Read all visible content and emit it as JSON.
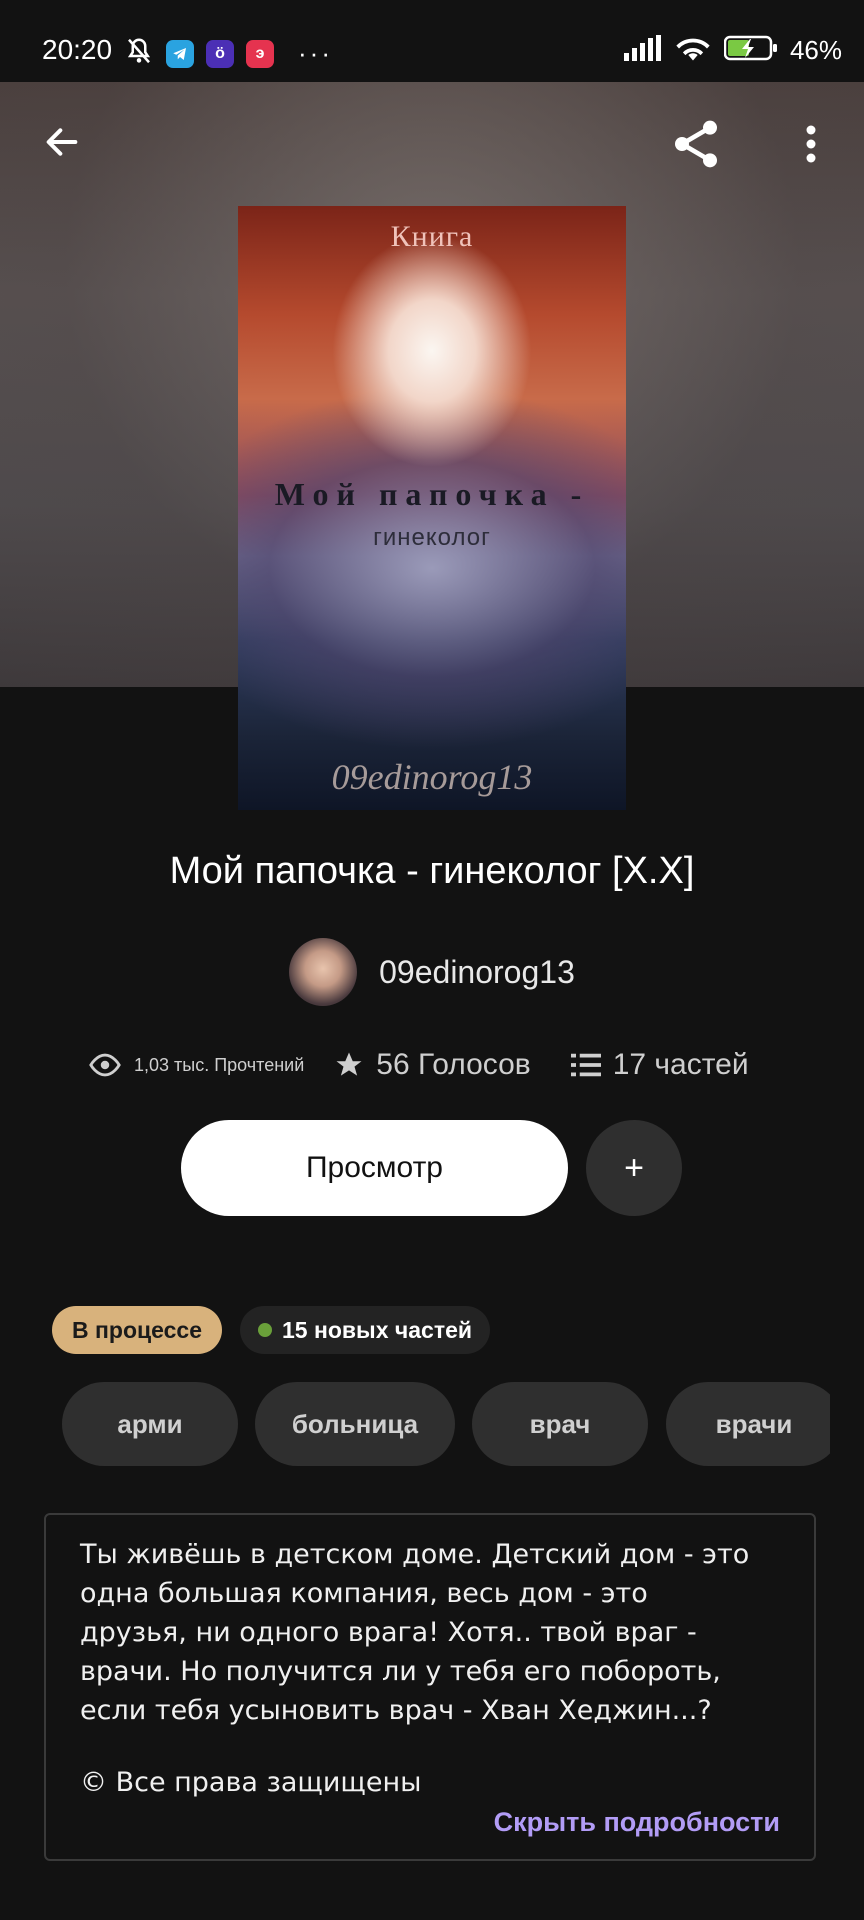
{
  "status_bar": {
    "time": "20:20",
    "battery": "46%",
    "icons": [
      "muted-bell-icon",
      "telegram-icon",
      "app-icon",
      "app-icon",
      "more-icon",
      "signal-icon",
      "wifi-icon",
      "battery-icon"
    ]
  },
  "header": {
    "back_icon": "back-arrow-icon",
    "share_icon": "share-icon",
    "menu_icon": "more-vertical-icon"
  },
  "cover": {
    "top_text": "Книга",
    "title_text": "Мой папочка -",
    "subtitle_text": "гинеколог",
    "author_text": "09edinorog13"
  },
  "book": {
    "title": "Мой папочка - гинеколог [X.X]",
    "author": "09edinorog13"
  },
  "stats": {
    "reads": "1,03 тыс. Прочтений",
    "votes": "56 Голосов",
    "parts": "17 частей"
  },
  "actions": {
    "view_label": "Просмотр",
    "add_label": "+"
  },
  "badges": {
    "status": "В процессе",
    "new_parts": "15 новых частей"
  },
  "tags": [
    "арми",
    "больница",
    "врач",
    "врачи"
  ],
  "description": {
    "text": "Ты живёшь в детском доме. Детский дом - это одна большая компания, весь дом - это друзья, ни одного врага! Хотя.. твой враг - врачи. Но получится ли у тебя его побороть, если тебя усыновить врач - Хван Хеджин...?",
    "rights": "© Все права защищены",
    "toggle_label": "Скрыть подробности"
  },
  "colors": {
    "background": "#121212",
    "status_badge": "#d8b27c",
    "link": "#b29cf6",
    "new_dot": "#6aa03a"
  }
}
